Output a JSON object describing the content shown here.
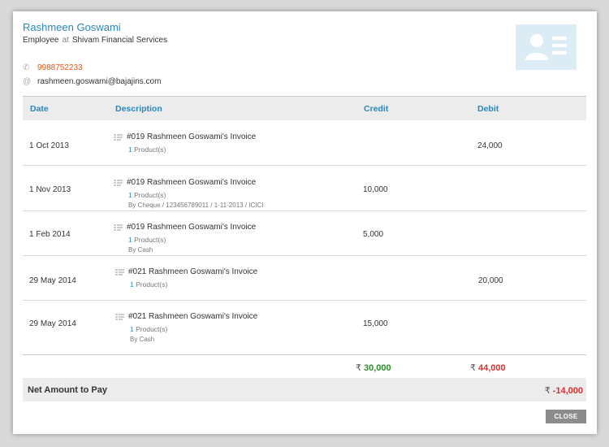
{
  "contact": {
    "name": "Rashmeen Goswami",
    "role": "Employee",
    "at_word": "at",
    "company": "Shivam Financial Services",
    "phone": "9988752233",
    "email": "rashmeen.goswami@bajajins.com"
  },
  "table": {
    "headers": {
      "date": "Date",
      "description": "Description",
      "credit": "Credit",
      "debit": "Debit"
    },
    "rows": [
      {
        "date": "1 Oct 2013",
        "invoice": "#019  Rashmeen Goswami's Invoice",
        "product_count": "1",
        "product_label": "Product(s)",
        "payment": "",
        "credit": "",
        "debit": "24,000"
      },
      {
        "date": "1 Nov 2013",
        "invoice": "#019  Rashmeen Goswami's Invoice",
        "product_count": "1",
        "product_label": "Product(s)",
        "payment": "By Cheque / 123456789011 / 1-11-2013 / ICICI",
        "credit": "10,000",
        "debit": ""
      },
      {
        "date": "1 Feb 2014",
        "invoice": "#019  Rashmeen Goswami's Invoice",
        "product_count": "1",
        "product_label": "Product(s)",
        "payment": "By Cash",
        "credit": "5,000",
        "debit": ""
      },
      {
        "date": "29 May 2014",
        "invoice": "#021  Rashmeen Goswami's Invoice",
        "product_count": "1",
        "product_label": "Product(s)",
        "payment": "",
        "credit": "",
        "debit": "20,000"
      },
      {
        "date": "29 May 2014",
        "invoice": "#021  Rashmeen Goswami's Invoice",
        "product_count": "1",
        "product_label": "Product(s)",
        "payment": "By Cash",
        "credit": "15,000",
        "debit": ""
      }
    ]
  },
  "totals": {
    "currency": "₹",
    "credit": "30,000",
    "debit": "44,000"
  },
  "net": {
    "label": "Net Amount to Pay",
    "currency": "₹",
    "value": "-14,000"
  },
  "close_label": "CLOSE",
  "colors": {
    "accent": "#2a87b8",
    "phone": "#e05a1e",
    "positive": "#2e8b2e",
    "negative": "#d93030"
  }
}
